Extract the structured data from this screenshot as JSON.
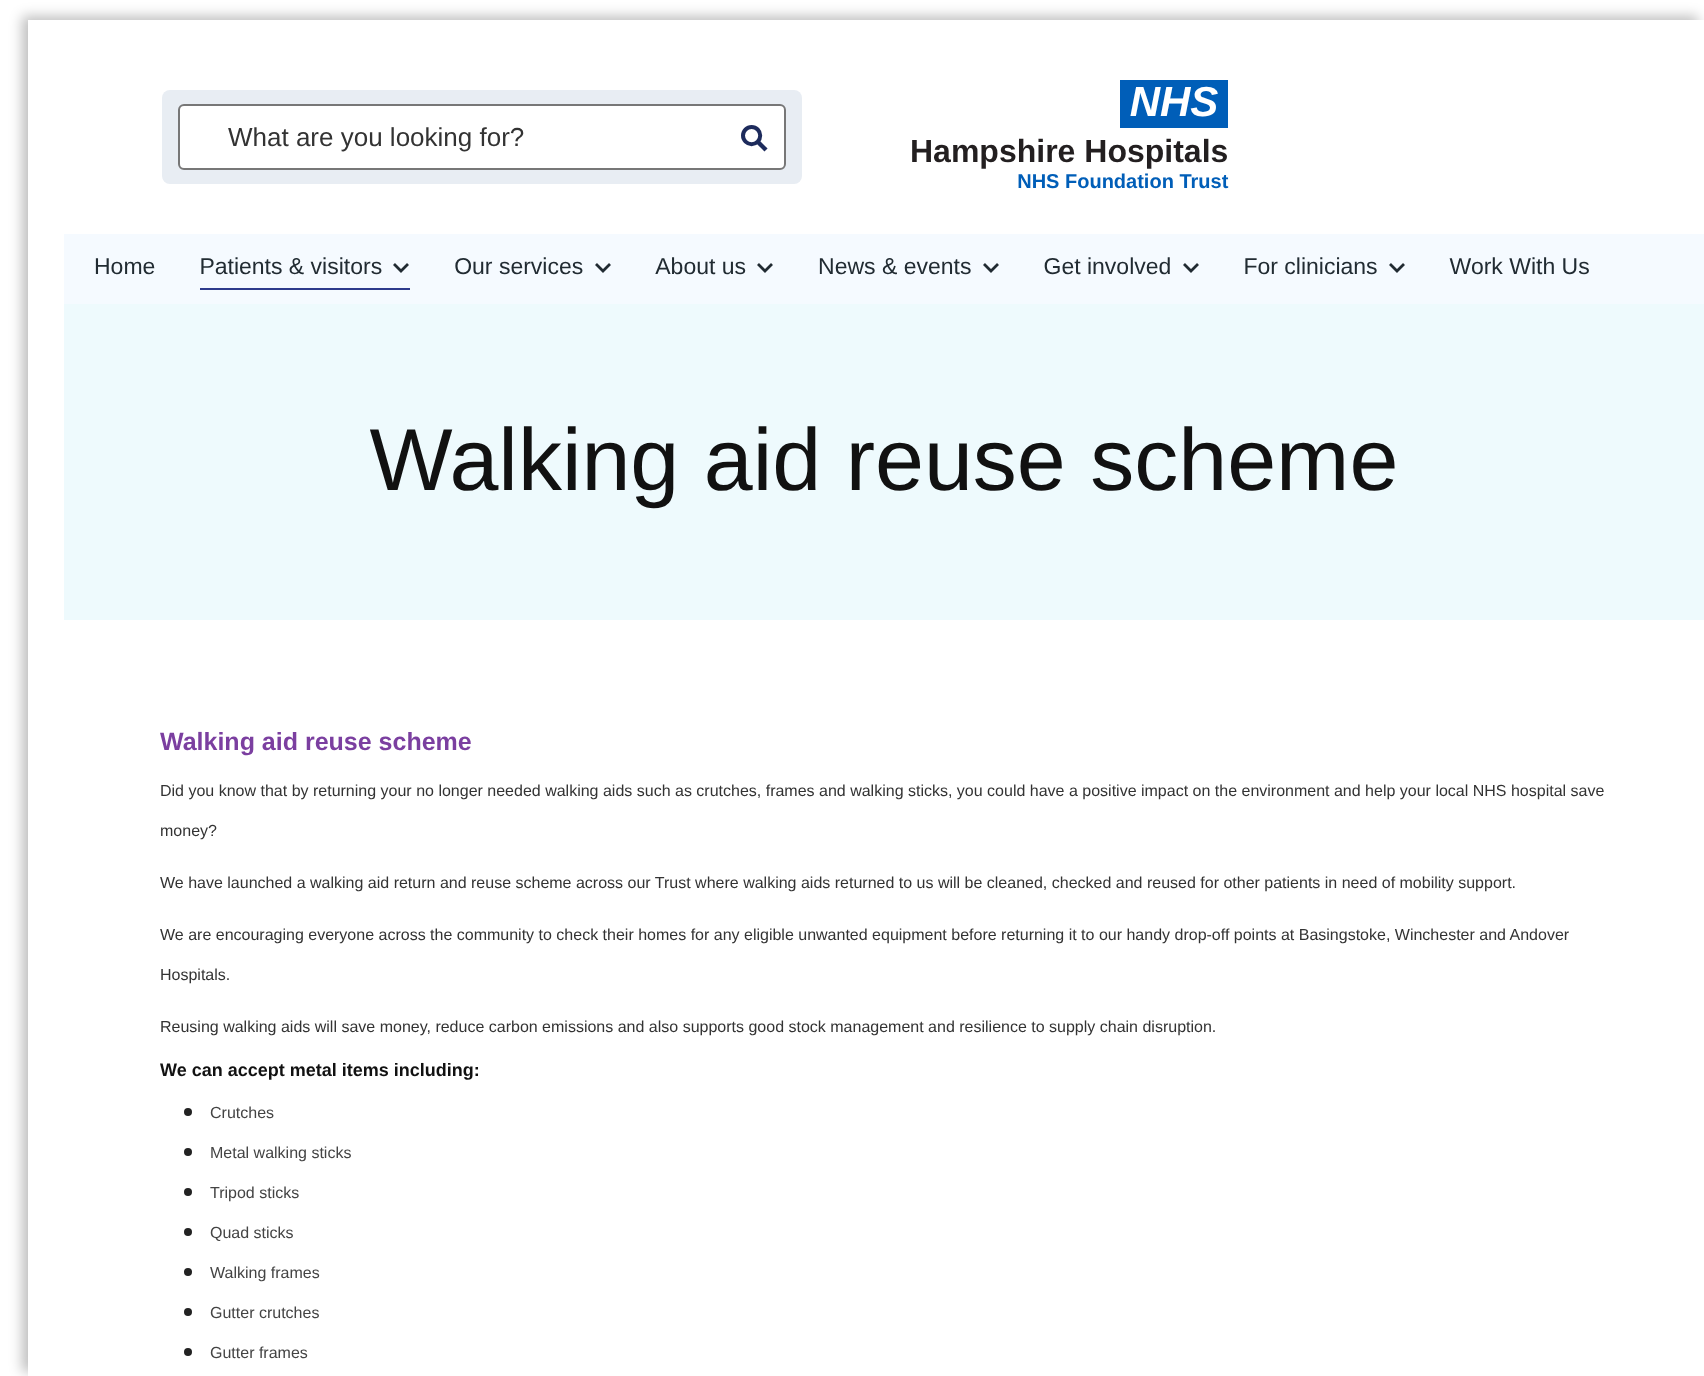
{
  "search": {
    "placeholder": "What are you looking for?"
  },
  "logo": {
    "badge": "NHS",
    "name": "Hampshire Hospitals",
    "subtitle": "NHS Foundation Trust"
  },
  "nav": [
    {
      "label": "Home",
      "selected": false,
      "dropdown": false
    },
    {
      "label": "Patients & visitors",
      "selected": true,
      "dropdown": true
    },
    {
      "label": "Our services",
      "selected": false,
      "dropdown": true
    },
    {
      "label": "About us",
      "selected": false,
      "dropdown": true
    },
    {
      "label": "News & events",
      "selected": false,
      "dropdown": true
    },
    {
      "label": "Get involved",
      "selected": false,
      "dropdown": true
    },
    {
      "label": "For clinicians",
      "selected": false,
      "dropdown": true
    },
    {
      "label": "Work With Us",
      "selected": false,
      "dropdown": false
    }
  ],
  "hero": {
    "title": "Walking aid reuse scheme"
  },
  "article": {
    "heading": "Walking aid reuse scheme",
    "paragraphs": [
      "Did you know that by returning your no longer needed walking aids such as crutches, frames and walking sticks, you could have a positive impact on the environment and help your local NHS hospital save money?",
      "We have launched a walking aid return and reuse scheme across our Trust where walking aids returned to us will be cleaned, checked and reused for other patients in need of mobility support.",
      "We are encouraging everyone across the community to check their homes for any eligible unwanted equipment before returning it to our handy drop-off points at Basingstoke, Winchester and Andover Hospitals.",
      "Reusing walking aids will save money, reduce carbon emissions and also supports good stock management and resilience to supply chain disruption."
    ],
    "list_title": "We can accept metal items including:",
    "items": [
      "Crutches",
      "Metal walking sticks",
      "Tripod sticks",
      "Quad sticks",
      "Walking frames",
      "Gutter crutches",
      "Gutter frames"
    ]
  }
}
